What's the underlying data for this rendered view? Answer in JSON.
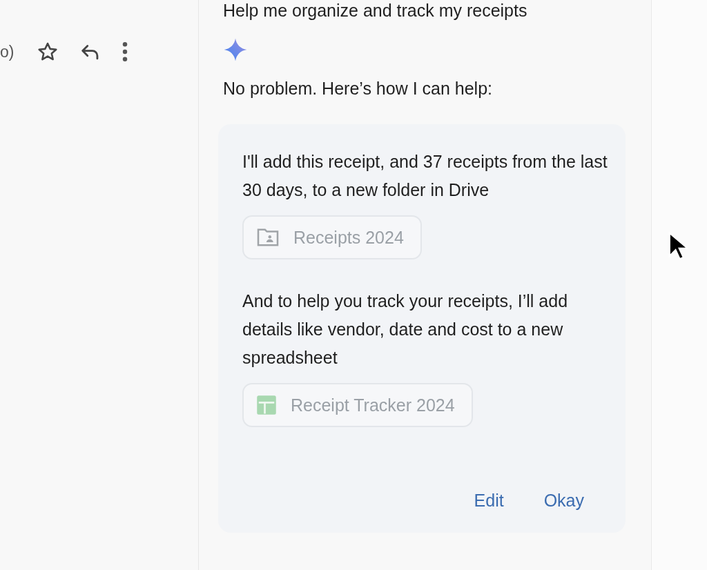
{
  "toolbar": {
    "sender_fragment": "o)"
  },
  "prompt": "Help me organize and track my receipts",
  "response": {
    "intro": "No problem. Here’s how I can help:",
    "steps": [
      {
        "text": "I'll add this receipt, and 37 receipts from the last 30 days, to a new folder in Drive",
        "chip": {
          "kind": "folder",
          "label": "Receipts 2024"
        }
      },
      {
        "text": "And to help you track your receipts, I’ll add details like vendor, date and cost to a new spreadsheet",
        "chip": {
          "kind": "sheet",
          "label": "Receipt Tracker 2024"
        }
      }
    ],
    "actions": [
      "Edit",
      "Okay"
    ]
  }
}
